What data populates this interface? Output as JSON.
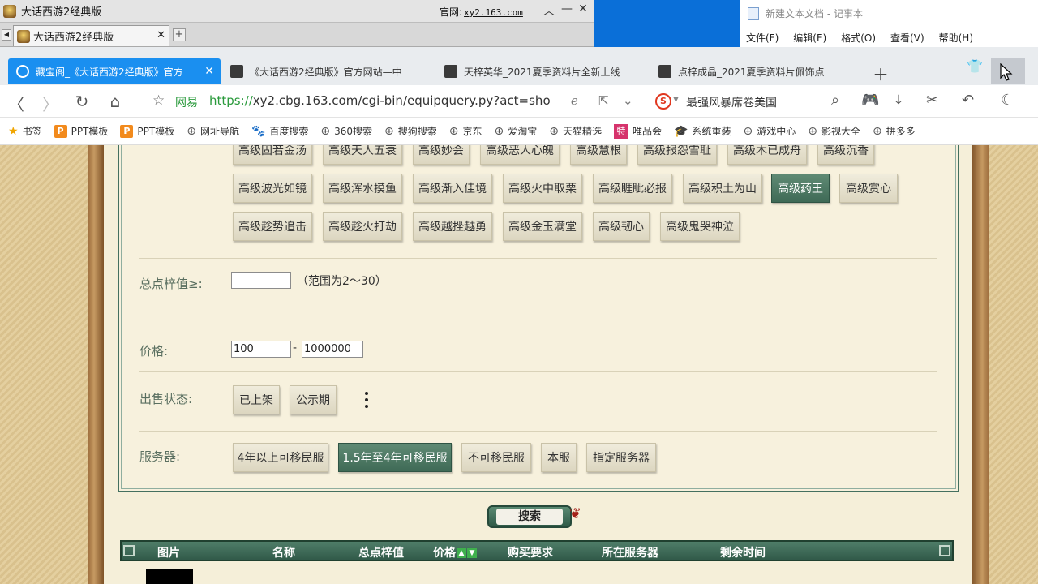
{
  "game_client": {
    "title": "大话西游2经典版",
    "official_label": "官网:",
    "official_url": "xy2.163.com",
    "tab_label": "大话西游2经典版"
  },
  "notepad": {
    "title": "新建文本文档 - 记事本",
    "menu": [
      "文件(F)",
      "编辑(E)",
      "格式(O)",
      "查看(V)",
      "帮助(H)"
    ]
  },
  "browser": {
    "tabs": [
      {
        "label": "藏宝阁_《大话西游2经典版》官方"
      },
      {
        "label": "《大话西游2经典版》官方网站—中"
      },
      {
        "label": "天梓英华_2021夏季资料片全新上线"
      },
      {
        "label": "点梓成晶_2021夏季资料片佩饰点"
      }
    ],
    "site_name": "网易",
    "url_proto": "https://",
    "url_rest": "xy2.cbg.163.com/cgi-bin/equipquery.py?act=sho",
    "search_hint": "最强风暴席卷美国",
    "bookmarks": [
      "书签",
      "PPT模板",
      "PPT模板",
      "网址导航",
      "百度搜索",
      "360搜索",
      "搜狗搜索",
      "京东",
      "爱淘宝",
      "天猫精选",
      "唯品会",
      "系统重装",
      "游戏中心",
      "影视大全",
      "拼多多"
    ]
  },
  "skills": {
    "row1": [
      "高级固若金汤",
      "高级天人五衰",
      "高级妙会",
      "高级恶人心魄",
      "高级慧根",
      "高级报怨雪耻",
      "高级木已成舟",
      "高级沉香"
    ],
    "row2": [
      "高级波光如镜",
      "高级浑水摸鱼",
      "高级渐入佳境",
      "高级火中取栗",
      "高级睚眦必报",
      "高级积土为山",
      "高级药王",
      "高级赏心"
    ],
    "row3": [
      "高级趁势追击",
      "高级趁火打劫",
      "高级越挫越勇",
      "高级金玉满堂",
      "高级韧心",
      "高级鬼哭神泣"
    ],
    "selected": "高级药王"
  },
  "total_points": {
    "label": "总点梓值≥:",
    "value": "",
    "range_hint": "（范围为2〜30）"
  },
  "price": {
    "label": "价格:",
    "min": "100",
    "dash": "-",
    "max": "1000000"
  },
  "sale_status": {
    "label": "出售状态:",
    "options": [
      "已上架",
      "公示期"
    ]
  },
  "server": {
    "label": "服务器:",
    "options": [
      "4年以上可移民服",
      "1.5年至4年可移民服",
      "不可移民服",
      "本服",
      "指定服务器"
    ],
    "selected": "1.5年至4年可移民服"
  },
  "search_button": "搜索",
  "results_header": [
    "图片",
    "名称",
    "总点梓值",
    "价格",
    "购买要求",
    "所在服务器",
    "剩余时间"
  ],
  "colors": {
    "accent_green": "#3f6a56",
    "browser_active_tab": "#1a8ff0",
    "parchment": "#f5efd9"
  }
}
